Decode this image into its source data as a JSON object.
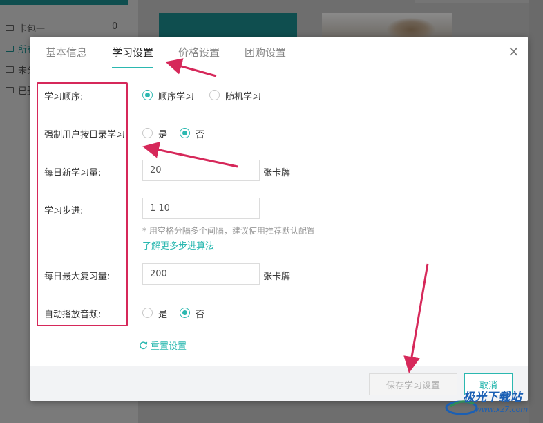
{
  "background": {
    "sidebar_items": [
      {
        "label": "卡包一",
        "count": "0"
      },
      {
        "label": "所有"
      },
      {
        "label": "未分"
      },
      {
        "label": "已删"
      }
    ]
  },
  "dialog": {
    "tabs": [
      {
        "label": "基本信息",
        "active": false
      },
      {
        "label": "学习设置",
        "active": true
      },
      {
        "label": "价格设置",
        "active": false
      },
      {
        "label": "团购设置",
        "active": false
      }
    ],
    "close_symbol": "×"
  },
  "form": {
    "study_order": {
      "label": "学习顺序:",
      "options": [
        "顺序学习",
        "随机学习"
      ],
      "selected": "顺序学习"
    },
    "force_catalog": {
      "label": "强制用户按目录学习:",
      "options": [
        "是",
        "否"
      ],
      "selected": "否"
    },
    "daily_new": {
      "label": "每日新学习量:",
      "value": "20",
      "unit": "张卡牌"
    },
    "learning_steps": {
      "label": "学习步进:",
      "value": "1 10",
      "hint": "* 用空格分隔多个间隔，建议使用推荐默认配置",
      "link": "了解更多步进算法"
    },
    "daily_max_review": {
      "label": "每日最大复习量:",
      "value": "200",
      "unit": "张卡牌"
    },
    "auto_audio": {
      "label": "自动播放音频:",
      "options": [
        "是",
        "否"
      ],
      "selected": "否"
    },
    "reset": {
      "icon": "refresh-icon",
      "label": "重置设置"
    }
  },
  "footer": {
    "save_label": "保存学习设置",
    "cancel_label": "取消"
  },
  "watermark": {
    "text": "极光下载站",
    "url": "www.xz7.com"
  },
  "colors": {
    "accent": "#2bb8b0",
    "annotation": "#d6285a",
    "overlay": "#6e6e6e",
    "background_teal": "#0f4e4f"
  }
}
